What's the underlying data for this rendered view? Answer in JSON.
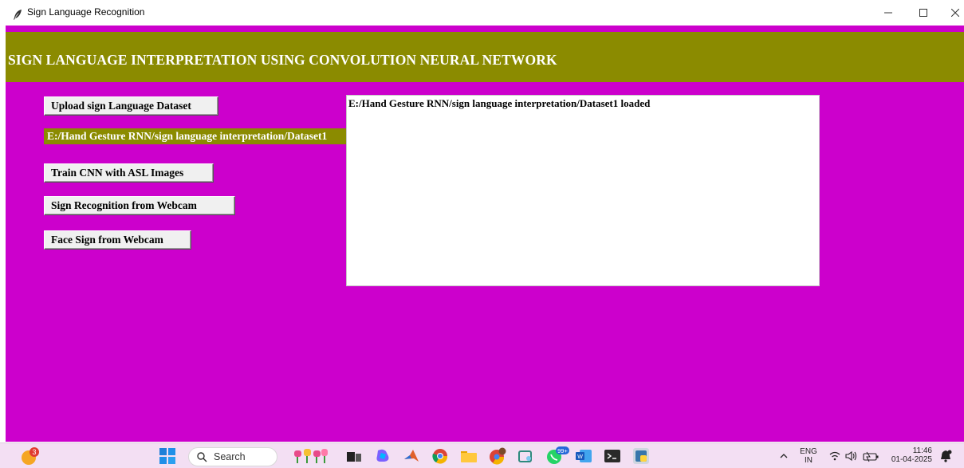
{
  "window": {
    "title": "Sign Language Recognition"
  },
  "header": {
    "title": "SIGN LANGUAGE INTERPRETATION USING CONVOLUTION NEURAL NETWORK"
  },
  "colors": {
    "app_background": "#cc00cc",
    "header_background": "#8b8b00",
    "button_background": "#f0f0f0"
  },
  "buttons": {
    "upload": "Upload sign Language Dataset",
    "train": "Train CNN with ASL Images",
    "recognize": "Sign Recognition from Webcam",
    "face": "Face Sign from Webcam"
  },
  "path_label": "E:/Hand Gesture RNN/sign language interpretation/Dataset1",
  "output": {
    "text": "E:/Hand Gesture RNN/sign language interpretation/Dataset1 loaded"
  },
  "taskbar": {
    "notification_badge": "3",
    "search_placeholder": "Search",
    "whatsapp_badge": "99+",
    "language_top": "ENG",
    "language_bottom": "IN",
    "time": "11:46",
    "date": "01-04-2025"
  },
  "icons": [
    "feather-icon",
    "minimize-icon",
    "maximize-icon",
    "close-icon",
    "windows-start-icon",
    "search-icon",
    "wifi-icon",
    "volume-icon",
    "battery-icon"
  ]
}
